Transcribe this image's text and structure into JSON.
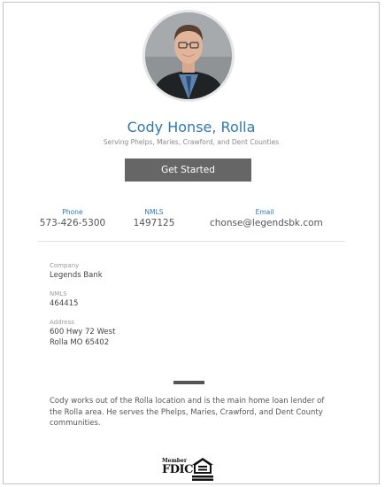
{
  "profile": {
    "name": "Cody Honse, Rolla",
    "subtitle": "Serving Phelps, Maries, Crawford, and Dent Counties",
    "cta_label": "Get Started"
  },
  "contact": {
    "phone_label": "Phone",
    "phone_value": "573-426-5300",
    "nmls_label": "NMLS",
    "nmls_value": "1497125",
    "email_label": "Email",
    "email_value": "chonse@legendsbk.com"
  },
  "details": {
    "company_label": "Company",
    "company_value": "Legends Bank",
    "nmls_label": "NMLS",
    "nmls_value": "464415",
    "address_label": "Address",
    "address_line1": "600 Hwy 72 West",
    "address_line2": "Rolla MO 65402"
  },
  "bio": "Cody works out of the Rolla location and is the main home loan lender of the Rolla area. He serves the Phelps, Maries, Crawford, and Dent County communities.",
  "badges": {
    "member_text": "Member",
    "fdic_text": "FDIC",
    "ehl_text": "EQUAL HOUSING LENDER"
  },
  "colors": {
    "accent": "#2f78b0",
    "button_bg": "#666666"
  }
}
